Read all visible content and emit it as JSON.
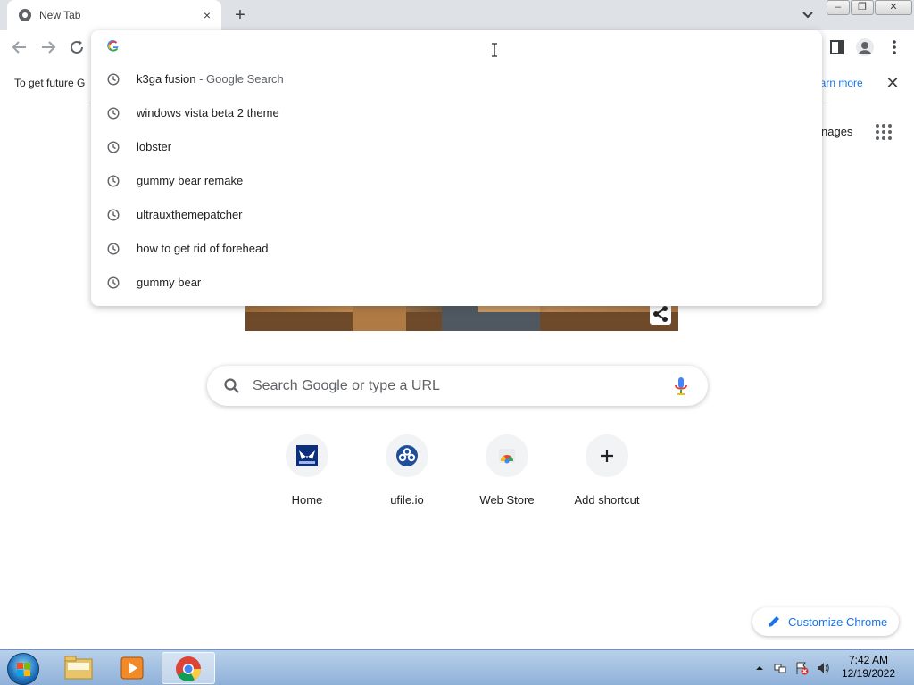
{
  "browser": {
    "tab": {
      "title": "New Tab",
      "close_label": "×"
    },
    "new_tab_label": "+",
    "window_controls": {
      "minimize": "–",
      "maximize": "❐",
      "close": "✕"
    }
  },
  "infobar": {
    "text": "To get future G",
    "link_label": "earn more",
    "close_label": "✕"
  },
  "omnibox": {
    "suggestions": [
      {
        "text": "k3ga fusion",
        "suffix": " - Google Search"
      },
      {
        "text": "windows vista beta 2 theme",
        "suffix": ""
      },
      {
        "text": "lobster",
        "suffix": ""
      },
      {
        "text": "gummy bear remake",
        "suffix": ""
      },
      {
        "text": "ultrauxthemepatcher",
        "suffix": ""
      },
      {
        "text": "how to get rid of forehead",
        "suffix": ""
      },
      {
        "text": "gummy bear",
        "suffix": ""
      }
    ]
  },
  "ntp": {
    "images_link": "nages",
    "search_placeholder": "Search Google or type a URL",
    "shortcuts": [
      {
        "label": "Home",
        "icon": "zeltal-logo-icon"
      },
      {
        "label": "ufile.io",
        "icon": "ufile-logo-icon"
      },
      {
        "label": "Web Store",
        "icon": "chrome-web-store-icon"
      },
      {
        "label": "Add shortcut",
        "icon": "plus-icon"
      }
    ],
    "customize_label": "Customize Chrome"
  },
  "taskbar": {
    "time": "7:42 AM",
    "date": "12/19/2022"
  },
  "colors": {
    "accent_blue": "#1a73e8",
    "tabstrip": "#dee1e6",
    "taskbar": "#8fb1d9"
  }
}
